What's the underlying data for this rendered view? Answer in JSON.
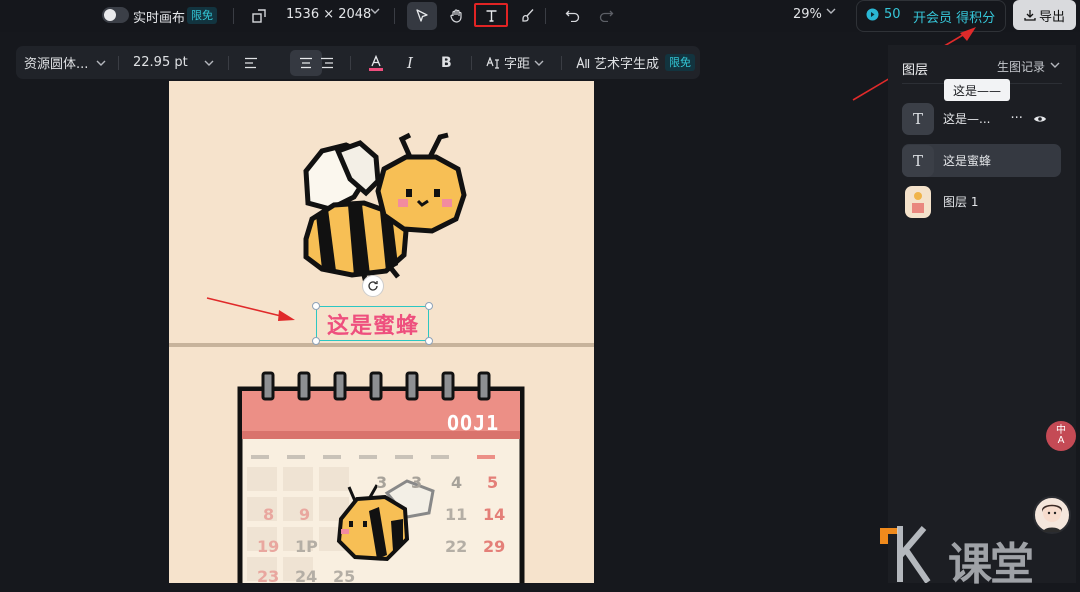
{
  "topbar": {
    "realtime_canvas": "实时画布",
    "limited_free": "限免",
    "canvas_size": "1536 × 2048",
    "zoom": "29%",
    "points": "50",
    "member_cta": "开会员 得积分",
    "export": "导出"
  },
  "text_toolbar": {
    "font": "资源圆体...",
    "font_size": "22.95 pt",
    "italic": "I",
    "bold": "B",
    "spacing": "字距",
    "art_text": "艺术字生成",
    "limited_free": "限免"
  },
  "canvas": {
    "selected_text": "这是蜜蜂",
    "calendar_header": "OOJ1",
    "calendar_numbers": [
      "3",
      "4",
      "5",
      "8",
      "9",
      "11",
      "14",
      "19",
      "1P",
      "22",
      "29",
      "23",
      "24",
      "25"
    ]
  },
  "right_panel": {
    "tab_layers": "图层",
    "tab_history": "生图记录",
    "tooltip": "这是——",
    "layers": [
      {
        "icon": "T",
        "label": "这是—..."
      },
      {
        "icon": "T",
        "label": "这是蜜蜂"
      },
      {
        "icon": "",
        "label": "图层 1"
      }
    ],
    "more": "···"
  },
  "side": {
    "lang_top": "中",
    "lang_bottom": "A"
  },
  "watermark": "课堂"
}
